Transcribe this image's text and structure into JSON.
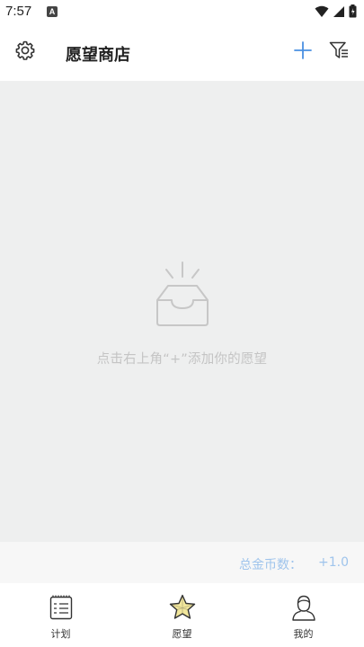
{
  "status_bar": {
    "time": "7:57",
    "notification_glyph": "A",
    "icons": [
      "wifi-icon",
      "signal-icon",
      "battery-icon"
    ]
  },
  "app_bar": {
    "title": "愿望商店",
    "icons": [
      "gear-icon",
      "plus-icon",
      "filter-icon"
    ],
    "accent_color": "#4a90e2"
  },
  "empty_state": {
    "icon": "empty-tray-icon",
    "message": "点击右上角“+”添加你的愿望"
  },
  "coin_bar": {
    "label": "总金币数：",
    "value": "+1.0",
    "color": "#9fc4ec"
  },
  "bottom_nav": {
    "items": [
      {
        "label": "计划",
        "icon": "plan-list-icon"
      },
      {
        "label": "愿望",
        "icon": "star-icon",
        "active": true
      },
      {
        "label": "我的",
        "icon": "person-icon"
      }
    ]
  }
}
